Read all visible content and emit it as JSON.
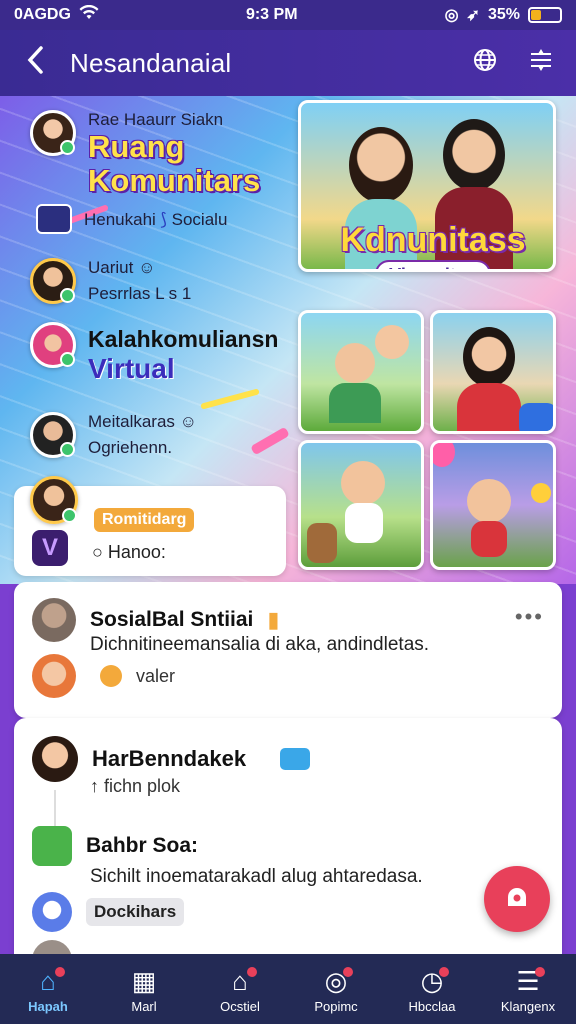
{
  "status": {
    "carrier": "0AGDG",
    "time": "9:3 PM",
    "battery": "35%",
    "battery_level": 0.35
  },
  "appbar": {
    "back_icon": "chevron-left-icon",
    "title": "Nesandanaial",
    "globe_icon": "globe-icon",
    "filter_icon": "sliders-icon"
  },
  "hero": {
    "item1_top": "Rae Haaurr Siakn",
    "item1_big1": "Ruang",
    "item1_big2": "Komunitars",
    "item2": "Henukahi",
    "item2b": "Socialu",
    "item3a": "Uariut ☺",
    "item3b": "Pesrrlas L   s   1",
    "item4_dark": "Kalahkomuliansn",
    "item4_virtual": "Virtual",
    "item5a": "Meitalkaras ☺",
    "item5b": "Ogriehenn.",
    "mini_pill": "Romitidarg",
    "mini_text": "Hanoo:",
    "badge_main": "Kdnunitass",
    "badge_sub": "Viraunitns"
  },
  "card1": {
    "title": "SosialBal Sntiiai",
    "body": "Dichnitineemansalia di aka, andindletas.",
    "meta": "valer"
  },
  "card2": {
    "title": "HarBenndakek",
    "meta": "fichn plok",
    "title2": "Bahbr Soa:",
    "body2": "Sichilt inoematarakadl alug ahtaredasa.",
    "tag": "Dockihars"
  },
  "nav": [
    {
      "label": "Hapah",
      "icon": "home-icon"
    },
    {
      "label": "Marl",
      "icon": "store-icon"
    },
    {
      "label": "Ocstiel",
      "icon": "house-icon"
    },
    {
      "label": "Popimc",
      "icon": "compass-icon"
    },
    {
      "label": "Hbcclaa",
      "icon": "clock-icon"
    },
    {
      "label": "Klangenx",
      "icon": "menu-icon"
    }
  ],
  "colors": {
    "accent": "#4b2fa8",
    "fab": "#e8405a",
    "navbar": "#232a55"
  }
}
